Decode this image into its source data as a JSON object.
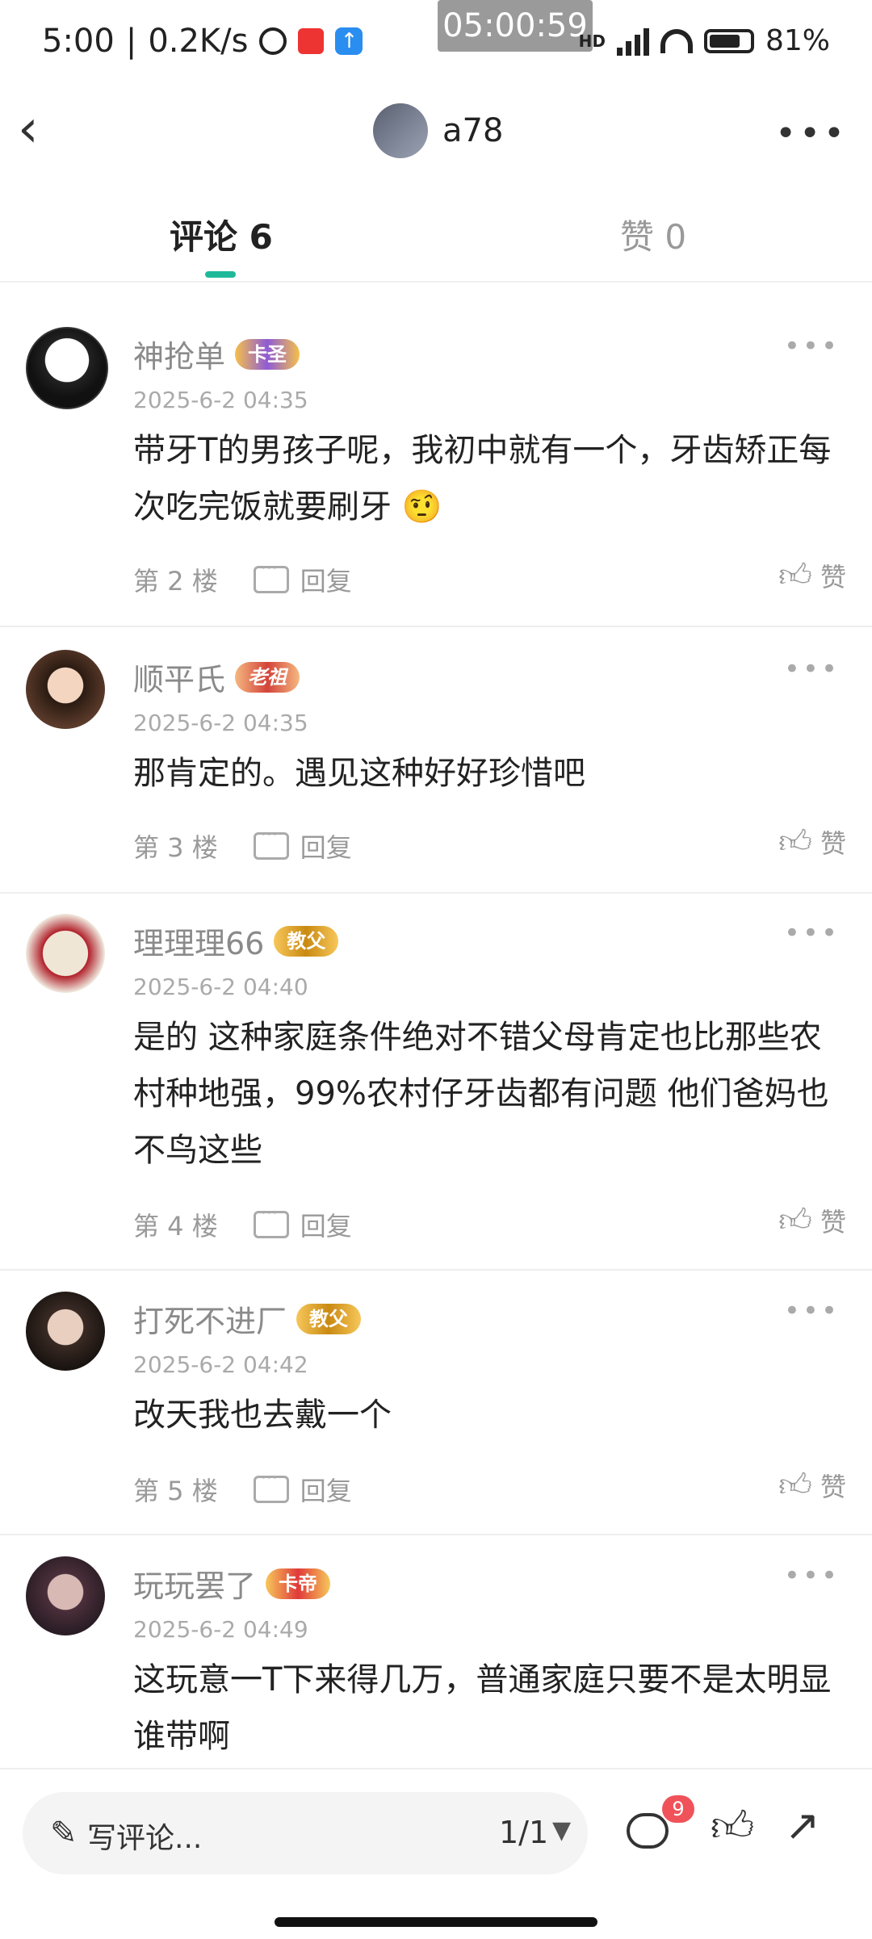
{
  "status_bar": {
    "time": "5:00",
    "net_speed": "0.2K/s",
    "clock_overlay": "05:00:59",
    "hd": "HD",
    "battery": "81%",
    "icons": [
      "alarm-icon",
      "app-icon",
      "upload-icon",
      "signal-icon",
      "wifi-icon",
      "battery-icon"
    ]
  },
  "header": {
    "back_icon": "chevron-left-icon",
    "username": "a78",
    "more": "•••"
  },
  "tabs": [
    {
      "label": "评论 6",
      "active": true
    },
    {
      "label": "赞 0",
      "active": false
    }
  ],
  "colors": {
    "accent": "#1fb99a",
    "badge_notify": "#f0525a"
  },
  "comments": [
    {
      "user": "神抢单",
      "badge": "卡圣",
      "time": "2025-6-2 04:35",
      "text": "带牙T的男孩子呢，我初中就有一个，牙齿矫正每次吃完饭就要刷牙 🤨",
      "floor": "第 2 楼",
      "reply": "回复",
      "like": "赞"
    },
    {
      "user": "顺平氏",
      "badge": "老祖",
      "time": "2025-6-2 04:35",
      "text": "那肯定的。遇见这种好好珍惜吧",
      "floor": "第 3 楼",
      "reply": "回复",
      "like": "赞"
    },
    {
      "user": "理理理66",
      "badge": "教父",
      "time": "2025-6-2 04:40",
      "text": "是的 这种家庭条件绝对不错父母肯定也比那些农村种地强，99%农村仔牙齿都有问题 他们爸妈也不鸟这些",
      "floor": "第 4 楼",
      "reply": "回复",
      "like": "赞"
    },
    {
      "user": "打死不进厂",
      "badge": "教父",
      "time": "2025-6-2 04:42",
      "text": "改天我也去戴一个",
      "floor": "第 5 楼",
      "reply": "回复",
      "like": "赞"
    },
    {
      "user": "玩玩罢了",
      "badge": "卡帝",
      "time": "2025-6-2 04:49",
      "text": "这玩意一T下来得几万，普通家庭只要不是太明显谁带啊",
      "floor": "",
      "reply": "",
      "like": ""
    }
  ],
  "bottom": {
    "placeholder": "写评论...",
    "page": "1/1",
    "comment_count": "9"
  }
}
